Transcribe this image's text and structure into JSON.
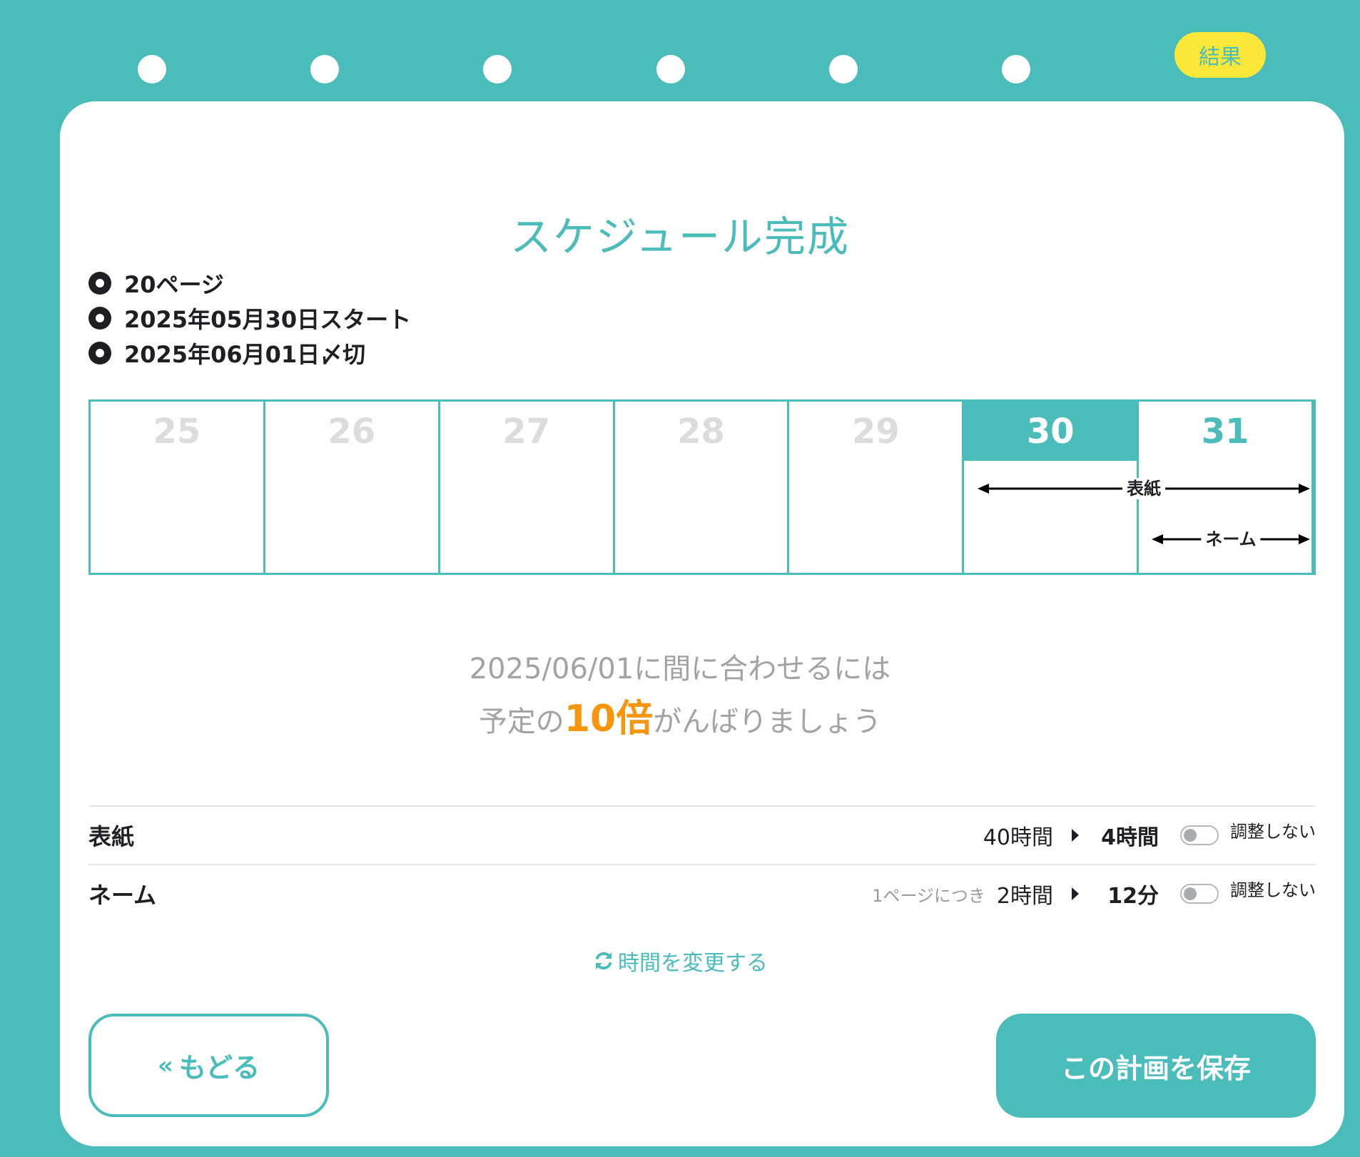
{
  "steps": {
    "result_label": "結果"
  },
  "title": "スケジュール完成",
  "info": [
    "20ページ",
    "2025年05月30日スタート",
    "2025年06月01日〆切"
  ],
  "calendar": {
    "days": [
      "25",
      "26",
      "27",
      "28",
      "29",
      "30",
      "31"
    ],
    "tasks": [
      "表紙",
      "ネーム"
    ]
  },
  "message": {
    "line1": "2025/06/01に間に合わせるには",
    "line2_prefix": "予定の",
    "line2_highlight": "10倍",
    "line2_suffix": "がんばりましょう"
  },
  "rows": [
    {
      "name": "表紙",
      "per_page": "",
      "from": "40時間",
      "to": "4時間",
      "toggle_label": "調整しない"
    },
    {
      "name": "ネーム",
      "per_page": "1ページにつき",
      "from": "2時間",
      "to": "12分",
      "toggle_label": "調整しない"
    }
  ],
  "change_time_label": "時間を変更する",
  "buttons": {
    "back": "もどる",
    "save": "この計画を保存"
  },
  "colors": {
    "teal": "#4abcb9",
    "yellow": "#fbe73a",
    "orange": "#f7960c"
  }
}
